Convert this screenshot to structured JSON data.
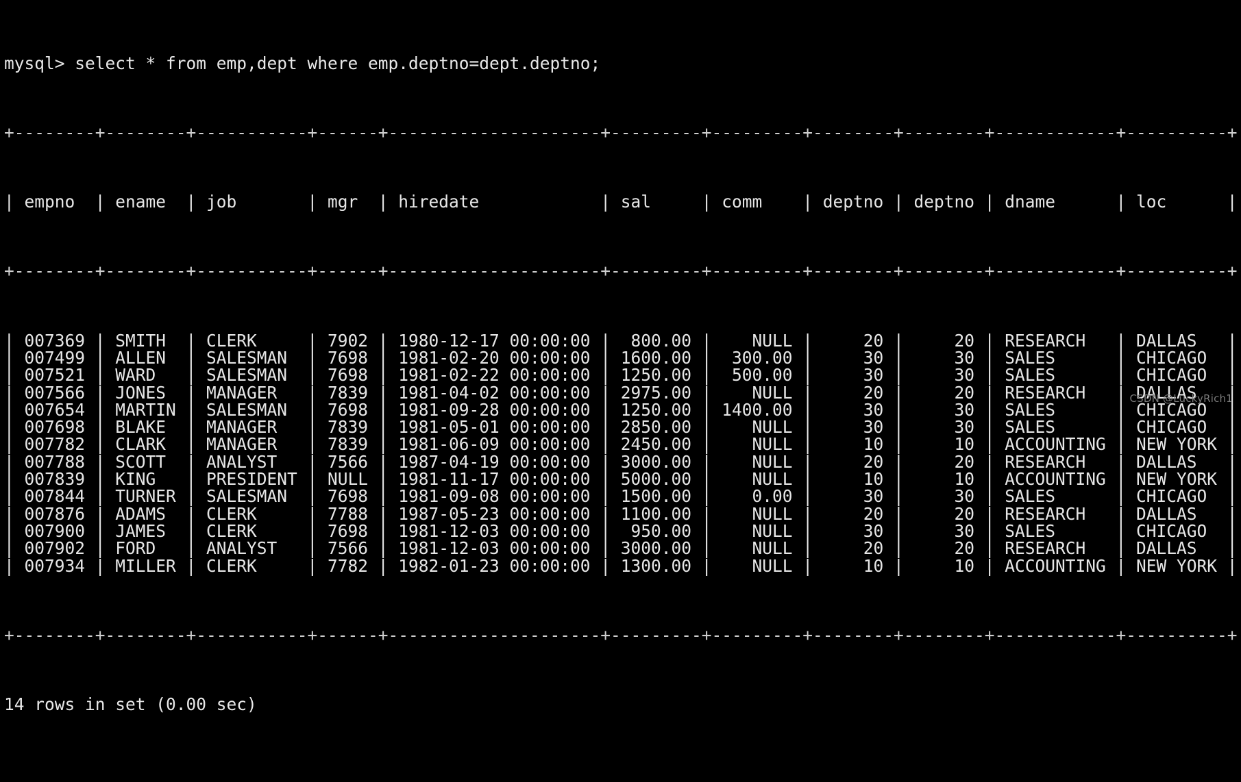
{
  "terminal": {
    "prompt": "mysql> ",
    "command": "select * from emp,dept where emp.deptno=dept.deptno;",
    "prompt_line": "mysql> select * from emp,dept where emp.deptno=dept.deptno;",
    "status": "14 rows in set (0.00 sec)",
    "row_count": 14,
    "elapsed": "0.00 sec",
    "watermark": "CSDN @LuckyRich1",
    "colors": {
      "background": "#000000",
      "foreground": "#e6e6e6",
      "border": "#cfcfcf",
      "watermark": "#7a7a7a"
    }
  },
  "result_table": {
    "separator": "+--------+--------+-----------+------+---------------------+---------+---------+--------+--------+------------+----------+",
    "header_line": "| empno  | ename  | job       | mgr  | hiredate            | sal     | comm    | deptno | deptno | dname      | loc      |",
    "columns": [
      {
        "name": "empno",
        "width": 6,
        "align": "right"
      },
      {
        "name": "ename",
        "width": 6,
        "align": "left"
      },
      {
        "name": "job",
        "width": 9,
        "align": "left"
      },
      {
        "name": "mgr",
        "width": 4,
        "align": "right"
      },
      {
        "name": "hiredate",
        "width": 19,
        "align": "left"
      },
      {
        "name": "sal",
        "width": 7,
        "align": "right"
      },
      {
        "name": "comm",
        "width": 7,
        "align": "right"
      },
      {
        "name": "deptno",
        "width": 6,
        "align": "right"
      },
      {
        "name": "deptno",
        "width": 6,
        "align": "right"
      },
      {
        "name": "dname",
        "width": 10,
        "align": "left"
      },
      {
        "name": "loc",
        "width": 8,
        "align": "left"
      }
    ],
    "rows": [
      [
        "007369",
        "SMITH",
        "CLERK",
        "7902",
        "1980-12-17 00:00:00",
        "800.00",
        "NULL",
        "20",
        "20",
        "RESEARCH",
        "DALLAS"
      ],
      [
        "007499",
        "ALLEN",
        "SALESMAN",
        "7698",
        "1981-02-20 00:00:00",
        "1600.00",
        "300.00",
        "30",
        "30",
        "SALES",
        "CHICAGO"
      ],
      [
        "007521",
        "WARD",
        "SALESMAN",
        "7698",
        "1981-02-22 00:00:00",
        "1250.00",
        "500.00",
        "30",
        "30",
        "SALES",
        "CHICAGO"
      ],
      [
        "007566",
        "JONES",
        "MANAGER",
        "7839",
        "1981-04-02 00:00:00",
        "2975.00",
        "NULL",
        "20",
        "20",
        "RESEARCH",
        "DALLAS"
      ],
      [
        "007654",
        "MARTIN",
        "SALESMAN",
        "7698",
        "1981-09-28 00:00:00",
        "1250.00",
        "1400.00",
        "30",
        "30",
        "SALES",
        "CHICAGO"
      ],
      [
        "007698",
        "BLAKE",
        "MANAGER",
        "7839",
        "1981-05-01 00:00:00",
        "2850.00",
        "NULL",
        "30",
        "30",
        "SALES",
        "CHICAGO"
      ],
      [
        "007782",
        "CLARK",
        "MANAGER",
        "7839",
        "1981-06-09 00:00:00",
        "2450.00",
        "NULL",
        "10",
        "10",
        "ACCOUNTING",
        "NEW YORK"
      ],
      [
        "007788",
        "SCOTT",
        "ANALYST",
        "7566",
        "1987-04-19 00:00:00",
        "3000.00",
        "NULL",
        "20",
        "20",
        "RESEARCH",
        "DALLAS"
      ],
      [
        "007839",
        "KING",
        "PRESIDENT",
        "NULL",
        "1981-11-17 00:00:00",
        "5000.00",
        "NULL",
        "10",
        "10",
        "ACCOUNTING",
        "NEW YORK"
      ],
      [
        "007844",
        "TURNER",
        "SALESMAN",
        "7698",
        "1981-09-08 00:00:00",
        "1500.00",
        "0.00",
        "30",
        "30",
        "SALES",
        "CHICAGO"
      ],
      [
        "007876",
        "ADAMS",
        "CLERK",
        "7788",
        "1987-05-23 00:00:00",
        "1100.00",
        "NULL",
        "20",
        "20",
        "RESEARCH",
        "DALLAS"
      ],
      [
        "007900",
        "JAMES",
        "CLERK",
        "7698",
        "1981-12-03 00:00:00",
        "950.00",
        "NULL",
        "30",
        "30",
        "SALES",
        "CHICAGO"
      ],
      [
        "007902",
        "FORD",
        "ANALYST",
        "7566",
        "1981-12-03 00:00:00",
        "3000.00",
        "NULL",
        "20",
        "20",
        "RESEARCH",
        "DALLAS"
      ],
      [
        "007934",
        "MILLER",
        "CLERK",
        "7782",
        "1982-01-23 00:00:00",
        "1300.00",
        "NULL",
        "10",
        "10",
        "ACCOUNTING",
        "NEW YORK"
      ]
    ]
  }
}
